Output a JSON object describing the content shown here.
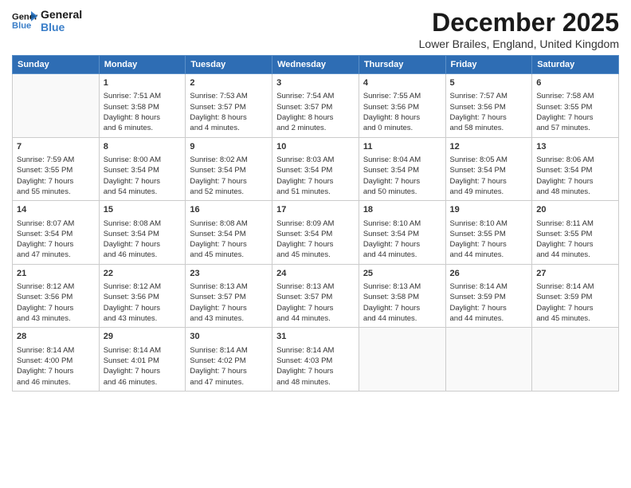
{
  "logo": {
    "line1": "General",
    "line2": "Blue"
  },
  "header": {
    "month": "December 2025",
    "location": "Lower Brailes, England, United Kingdom"
  },
  "weekdays": [
    "Sunday",
    "Monday",
    "Tuesday",
    "Wednesday",
    "Thursday",
    "Friday",
    "Saturday"
  ],
  "weeks": [
    [
      {
        "day": "",
        "content": ""
      },
      {
        "day": "1",
        "content": "Sunrise: 7:51 AM\nSunset: 3:58 PM\nDaylight: 8 hours\nand 6 minutes."
      },
      {
        "day": "2",
        "content": "Sunrise: 7:53 AM\nSunset: 3:57 PM\nDaylight: 8 hours\nand 4 minutes."
      },
      {
        "day": "3",
        "content": "Sunrise: 7:54 AM\nSunset: 3:57 PM\nDaylight: 8 hours\nand 2 minutes."
      },
      {
        "day": "4",
        "content": "Sunrise: 7:55 AM\nSunset: 3:56 PM\nDaylight: 8 hours\nand 0 minutes."
      },
      {
        "day": "5",
        "content": "Sunrise: 7:57 AM\nSunset: 3:56 PM\nDaylight: 7 hours\nand 58 minutes."
      },
      {
        "day": "6",
        "content": "Sunrise: 7:58 AM\nSunset: 3:55 PM\nDaylight: 7 hours\nand 57 minutes."
      }
    ],
    [
      {
        "day": "7",
        "content": "Sunrise: 7:59 AM\nSunset: 3:55 PM\nDaylight: 7 hours\nand 55 minutes."
      },
      {
        "day": "8",
        "content": "Sunrise: 8:00 AM\nSunset: 3:54 PM\nDaylight: 7 hours\nand 54 minutes."
      },
      {
        "day": "9",
        "content": "Sunrise: 8:02 AM\nSunset: 3:54 PM\nDaylight: 7 hours\nand 52 minutes."
      },
      {
        "day": "10",
        "content": "Sunrise: 8:03 AM\nSunset: 3:54 PM\nDaylight: 7 hours\nand 51 minutes."
      },
      {
        "day": "11",
        "content": "Sunrise: 8:04 AM\nSunset: 3:54 PM\nDaylight: 7 hours\nand 50 minutes."
      },
      {
        "day": "12",
        "content": "Sunrise: 8:05 AM\nSunset: 3:54 PM\nDaylight: 7 hours\nand 49 minutes."
      },
      {
        "day": "13",
        "content": "Sunrise: 8:06 AM\nSunset: 3:54 PM\nDaylight: 7 hours\nand 48 minutes."
      }
    ],
    [
      {
        "day": "14",
        "content": "Sunrise: 8:07 AM\nSunset: 3:54 PM\nDaylight: 7 hours\nand 47 minutes."
      },
      {
        "day": "15",
        "content": "Sunrise: 8:08 AM\nSunset: 3:54 PM\nDaylight: 7 hours\nand 46 minutes."
      },
      {
        "day": "16",
        "content": "Sunrise: 8:08 AM\nSunset: 3:54 PM\nDaylight: 7 hours\nand 45 minutes."
      },
      {
        "day": "17",
        "content": "Sunrise: 8:09 AM\nSunset: 3:54 PM\nDaylight: 7 hours\nand 45 minutes."
      },
      {
        "day": "18",
        "content": "Sunrise: 8:10 AM\nSunset: 3:54 PM\nDaylight: 7 hours\nand 44 minutes."
      },
      {
        "day": "19",
        "content": "Sunrise: 8:10 AM\nSunset: 3:55 PM\nDaylight: 7 hours\nand 44 minutes."
      },
      {
        "day": "20",
        "content": "Sunrise: 8:11 AM\nSunset: 3:55 PM\nDaylight: 7 hours\nand 44 minutes."
      }
    ],
    [
      {
        "day": "21",
        "content": "Sunrise: 8:12 AM\nSunset: 3:56 PM\nDaylight: 7 hours\nand 43 minutes."
      },
      {
        "day": "22",
        "content": "Sunrise: 8:12 AM\nSunset: 3:56 PM\nDaylight: 7 hours\nand 43 minutes."
      },
      {
        "day": "23",
        "content": "Sunrise: 8:13 AM\nSunset: 3:57 PM\nDaylight: 7 hours\nand 43 minutes."
      },
      {
        "day": "24",
        "content": "Sunrise: 8:13 AM\nSunset: 3:57 PM\nDaylight: 7 hours\nand 44 minutes."
      },
      {
        "day": "25",
        "content": "Sunrise: 8:13 AM\nSunset: 3:58 PM\nDaylight: 7 hours\nand 44 minutes."
      },
      {
        "day": "26",
        "content": "Sunrise: 8:14 AM\nSunset: 3:59 PM\nDaylight: 7 hours\nand 44 minutes."
      },
      {
        "day": "27",
        "content": "Sunrise: 8:14 AM\nSunset: 3:59 PM\nDaylight: 7 hours\nand 45 minutes."
      }
    ],
    [
      {
        "day": "28",
        "content": "Sunrise: 8:14 AM\nSunset: 4:00 PM\nDaylight: 7 hours\nand 46 minutes."
      },
      {
        "day": "29",
        "content": "Sunrise: 8:14 AM\nSunset: 4:01 PM\nDaylight: 7 hours\nand 46 minutes."
      },
      {
        "day": "30",
        "content": "Sunrise: 8:14 AM\nSunset: 4:02 PM\nDaylight: 7 hours\nand 47 minutes."
      },
      {
        "day": "31",
        "content": "Sunrise: 8:14 AM\nSunset: 4:03 PM\nDaylight: 7 hours\nand 48 minutes."
      },
      {
        "day": "",
        "content": ""
      },
      {
        "day": "",
        "content": ""
      },
      {
        "day": "",
        "content": ""
      }
    ]
  ]
}
